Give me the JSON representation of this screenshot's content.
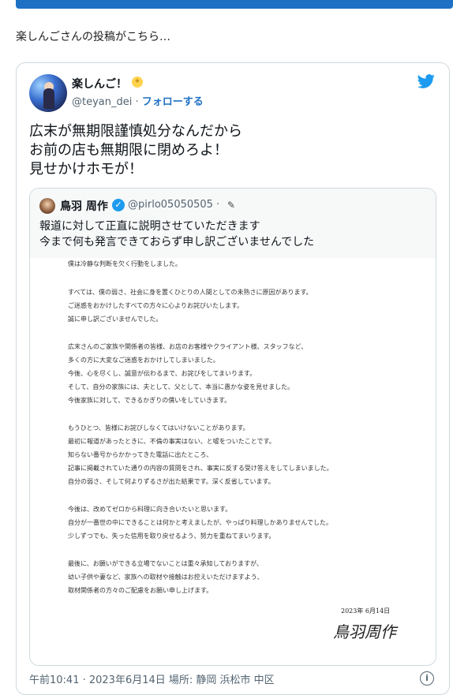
{
  "intro_text": "楽しんごさんの投稿がこちら…",
  "tweet": {
    "author_name": "楽しんご！",
    "handle": "@teyan_dei",
    "separator": " · ",
    "follow_label": "フォローする",
    "text": "広末が無期限謹慎処分なんだから\nお前の店も無期限に閉めろよ！\n見せかけホモが！"
  },
  "quoted": {
    "author_name": "鳥羽 周作",
    "handle": "@pirlo05050505",
    "dot": " ·",
    "text": "報道に対して正直に説明させていただきます\n今まで何も発言できておらず申し訳ございませんでした",
    "document_lines": [
      "僕は冷静な判断を欠く行動をしました。",
      "",
      "すべては、僕の弱さ、社会に身を置くひとりの人間としての未熟さに原因があります。",
      "ご迷惑をおかけしたすべての方々に心よりお詫びいたします。",
      "誠に申し訳ございませんでした。",
      "",
      "広末さんのご家族や関係者の皆様、お店のお客様やクライアント様、スタッフなど、",
      "多くの方に大変なご迷惑をおかけしてしまいました。",
      "今後、心を尽くし、誠意が伝わるまで、お詫びをしてまいります。",
      "そして、自分の家族には、夫として、父として、本当に愚かな姿を見せました。",
      "今後家族に対して、できるかぎりの償いをしていきます。",
      "",
      "もうひとつ、皆様にお詫びしなくてはいけないことがあります。",
      "最初に報道があったときに、不倫の事実はない、と嘘をついたことです。",
      "知らない番号からかかってきた電話に出たところ、",
      "記事に掲載されていた通りの内容の質問をされ、事実に反する受け答えをしてしまいました。",
      "自分の弱さ、そして何よりずるさが出た結果です。深く反省しています。",
      "",
      "今後は、改めてゼロから料理に向き合いたいと思います。",
      "自分が一番世の中にできることは何かと考えましたが、やっぱり料理しかありませんでした。",
      "少しずつでも、失った信用を取り戻せるよう、努力を重ねてまいります。",
      "",
      "最後に、お願いができる立場でないことは重々承知しておりますが、",
      "幼い子供や妻など、家族への取材や接触はお控えいただけますよう、",
      "取材関係者の方々のご配慮をお願い申し上げます。"
    ],
    "signature_date": "2023年 6月14日",
    "signature_name": "鳥羽周作"
  },
  "footer": {
    "timestamp": "午前10:41 · 2023年6月14日 場所: 静岡 浜松市 中区"
  },
  "colors": {
    "accent": "#1d70c4",
    "twitter_blue": "#1d9bf0",
    "muted": "#536471",
    "border": "#cfd9de"
  },
  "icons": [
    "twitter-bird-icon",
    "verified-badge-icon",
    "pencil-icon",
    "info-icon",
    "sparkle-star-icon"
  ]
}
